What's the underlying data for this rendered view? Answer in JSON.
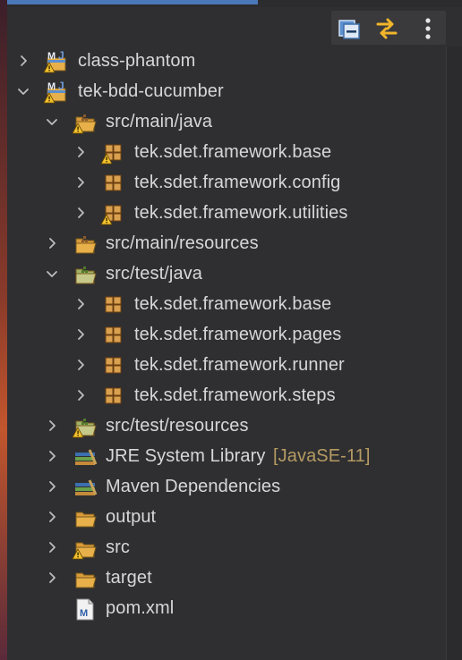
{
  "toolbar": {
    "collapse_all": "collapse-all-icon",
    "link_with_editor": "link-with-editor-icon",
    "view_menu": "view-menu-icon"
  },
  "tree": [
    {
      "label": "class-phantom",
      "level": 0,
      "expanded": false,
      "icon": "maven-project-icon",
      "warning": true
    },
    {
      "label": "tek-bdd-cucumber",
      "level": 0,
      "expanded": true,
      "icon": "maven-project-icon",
      "warning": true
    },
    {
      "label": "src/main/java",
      "level": 1,
      "expanded": true,
      "icon": "source-folder-icon",
      "warning": true
    },
    {
      "label": "tek.sdet.framework.base",
      "level": 2,
      "expanded": false,
      "icon": "package-icon",
      "warning": true
    },
    {
      "label": "tek.sdet.framework.config",
      "level": 2,
      "expanded": false,
      "icon": "package-icon",
      "warning": false
    },
    {
      "label": "tek.sdet.framework.utilities",
      "level": 2,
      "expanded": false,
      "icon": "package-icon",
      "warning": true
    },
    {
      "label": "src/main/resources",
      "level": 1,
      "expanded": false,
      "icon": "source-folder-icon",
      "warning": false
    },
    {
      "label": "src/test/java",
      "level": 1,
      "expanded": true,
      "icon": "test-source-folder-icon",
      "warning": false
    },
    {
      "label": "tek.sdet.framework.base",
      "level": 2,
      "expanded": false,
      "icon": "package-icon",
      "warning": false
    },
    {
      "label": "tek.sdet.framework.pages",
      "level": 2,
      "expanded": false,
      "icon": "package-icon",
      "warning": false
    },
    {
      "label": "tek.sdet.framework.runner",
      "level": 2,
      "expanded": false,
      "icon": "package-icon",
      "warning": false
    },
    {
      "label": "tek.sdet.framework.steps",
      "level": 2,
      "expanded": false,
      "icon": "package-icon",
      "warning": false
    },
    {
      "label": "src/test/resources",
      "level": 1,
      "expanded": false,
      "icon": "test-source-folder-icon",
      "warning": true
    },
    {
      "label": "JRE System Library",
      "decoration": "[JavaSE-11]",
      "level": 1,
      "expanded": false,
      "icon": "library-icon",
      "warning": false
    },
    {
      "label": "Maven Dependencies",
      "level": 1,
      "expanded": false,
      "icon": "library-icon",
      "warning": false
    },
    {
      "label": "output",
      "level": 1,
      "expanded": false,
      "icon": "folder-icon",
      "warning": false
    },
    {
      "label": "src",
      "level": 1,
      "expanded": false,
      "icon": "folder-icon",
      "warning": true
    },
    {
      "label": "target",
      "level": 1,
      "expanded": false,
      "icon": "folder-icon",
      "warning": false
    },
    {
      "label": "pom.xml",
      "level": 1,
      "leaf": true,
      "icon": "maven-pom-file-icon",
      "warning": false
    }
  ],
  "colors": {
    "background": "#2f2f31",
    "text": "#d7d7d7",
    "decoration": "#b59b62",
    "chevron": "#bdbdbd",
    "warning": "#f2c12e",
    "folder": "#e8b04a",
    "package": "#d9a04f"
  }
}
